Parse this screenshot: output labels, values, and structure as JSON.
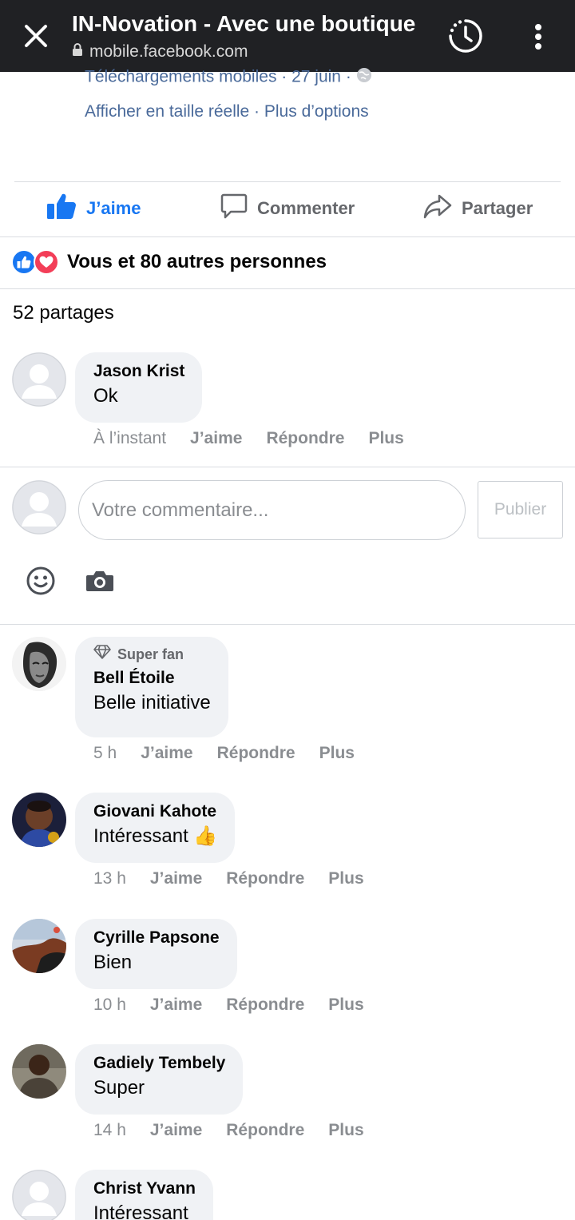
{
  "browser": {
    "title": "IN-Novation - Avec une boutique",
    "url": "mobile.facebook.com"
  },
  "post": {
    "meta": "Téléchargements mobiles · 27 juin ·",
    "links": "Afficher en taille réelle · Plus d’options"
  },
  "actions": {
    "like": "J’aime",
    "comment": "Commenter",
    "share": "Partager"
  },
  "reactions": {
    "text": "Vous et 80 autres personnes"
  },
  "shares": "52 partages",
  "composer": {
    "placeholder": "Votre commentaire...",
    "publish": "Publier"
  },
  "comments": [
    {
      "author": "Jason Krist",
      "text": "Ok",
      "time": "À l’instant",
      "like": "J’aime",
      "reply": "Répondre",
      "more": "Plus"
    },
    {
      "badge": "Super fan",
      "author": "Bell Étoile",
      "text": "Belle initiative",
      "time": "5 h",
      "like": "J’aime",
      "reply": "Répondre",
      "more": "Plus"
    },
    {
      "author": "Giovani Kahote",
      "text": "Intéressant",
      "emoji": "👍",
      "time": "13 h",
      "like": "J’aime",
      "reply": "Répondre",
      "more": "Plus"
    },
    {
      "author": "Cyrille Papsone",
      "text": "Bien",
      "time": "10 h",
      "like": "J’aime",
      "reply": "Répondre",
      "more": "Plus"
    },
    {
      "author": "Gadiely Tembely",
      "text": "Super",
      "time": "14 h",
      "like": "J’aime",
      "reply": "Répondre",
      "more": "Plus"
    },
    {
      "author": "Christ Yvann",
      "text": "Intéressant"
    }
  ],
  "colors": {
    "facebook_blue": "#1877f2",
    "love_red": "#f33e58",
    "link_blue": "#4a6a9a",
    "bubble_bg": "#f0f2f5",
    "topbar_bg": "#202124"
  },
  "icons": {
    "close": "close-icon",
    "lock": "lock-icon",
    "history": "history-icon",
    "more": "more-vert-icon",
    "globe": "globe-icon",
    "like": "thumbs-up-icon",
    "comment": "comment-icon",
    "share": "share-icon",
    "emoji": "emoji-icon",
    "camera": "camera-icon",
    "diamond": "diamond-icon"
  }
}
